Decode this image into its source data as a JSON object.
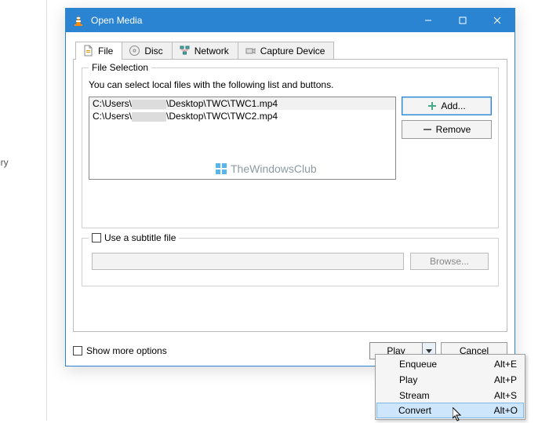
{
  "sidebar_hint": "ery",
  "titlebar": {
    "title": "Open Media"
  },
  "tabs": {
    "file": "File",
    "disc": "Disc",
    "network": "Network",
    "capture": "Capture Device"
  },
  "file_selection": {
    "group_title": "File Selection",
    "help": "You can select local files with the following list and buttons.",
    "files": [
      {
        "prefix": "C:\\Users\\",
        "suffix": "\\Desktop\\TWC\\TWC1.mp4"
      },
      {
        "prefix": "C:\\Users\\",
        "suffix": "\\Desktop\\TWC\\TWC2.mp4"
      }
    ],
    "add_label": "Add...",
    "remove_label": "Remove"
  },
  "watermark": "TheWindowsClub",
  "subtitle": {
    "checkbox_label": "Use a subtitle file",
    "browse_label": "Browse..."
  },
  "show_more": "Show more options",
  "buttons": {
    "play": "Play",
    "cancel": "Cancel"
  },
  "menu": [
    {
      "label": "Enqueue",
      "shortcut": "Alt+E"
    },
    {
      "label": "Play",
      "shortcut": "Alt+P"
    },
    {
      "label": "Stream",
      "shortcut": "Alt+S"
    },
    {
      "label": "Convert",
      "shortcut": "Alt+O"
    }
  ]
}
